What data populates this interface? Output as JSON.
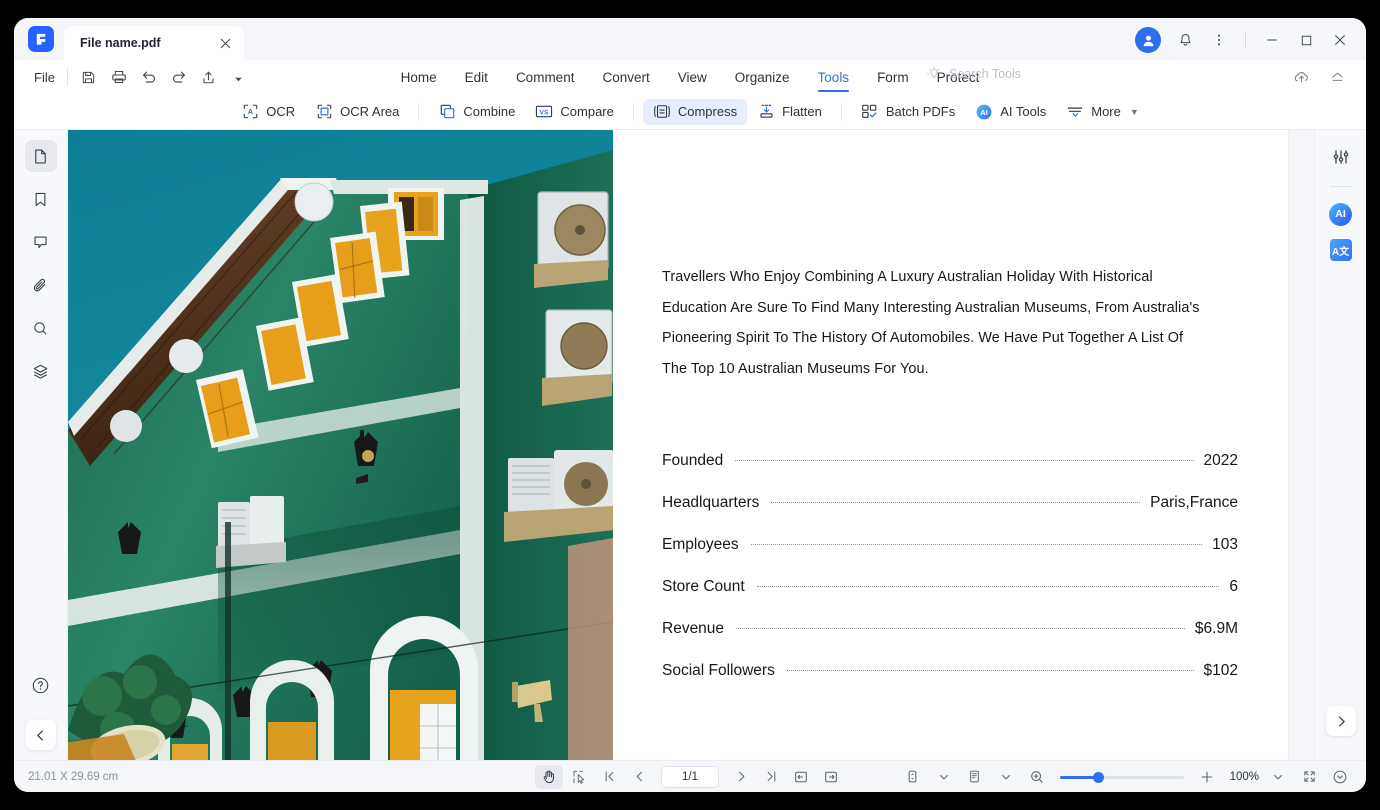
{
  "window": {
    "logo_icon": "pdfelement-logo-icon",
    "tab_title": "File name.pdf",
    "close_tab_icon": "close-icon",
    "account_icon": "user-avatar-icon",
    "notification_icon": "bell-icon",
    "overflow_icon": "kebab-menu-icon",
    "minimize_icon": "minimize-icon",
    "maximize_icon": "maximize-icon",
    "close_icon": "close-window-icon"
  },
  "quick_access": {
    "file_label": "File",
    "items": [
      {
        "name": "save-button",
        "icon": "save-icon"
      },
      {
        "name": "print-button",
        "icon": "print-icon"
      },
      {
        "name": "undo-button",
        "icon": "undo-icon"
      },
      {
        "name": "redo-button",
        "icon": "redo-icon"
      },
      {
        "name": "share-button",
        "icon": "share-icon"
      },
      {
        "name": "customize-toolbar-button",
        "icon": "chevron-down-filled-icon"
      }
    ]
  },
  "main_tabs": [
    {
      "label": "Home",
      "active": false
    },
    {
      "label": "Edit",
      "active": false
    },
    {
      "label": "Comment",
      "active": false
    },
    {
      "label": "Convert",
      "active": false
    },
    {
      "label": "View",
      "active": false
    },
    {
      "label": "Organize",
      "active": false
    },
    {
      "label": "Tools",
      "active": true
    },
    {
      "label": "Form",
      "active": false
    },
    {
      "label": "Protect",
      "active": false
    }
  ],
  "search": {
    "icon": "lightbulb-icon",
    "placeholder": "Search Tools"
  },
  "ribbon_right": {
    "cloud_icon": "cloud-upload-icon",
    "collapse_icon": "collapse-ribbon-icon"
  },
  "tools_ribbon": [
    {
      "label": "OCR",
      "icon": "ocr-icon",
      "active": false
    },
    {
      "label": "OCR Area",
      "icon": "ocr-area-icon",
      "active": false
    },
    {
      "label": "Combine",
      "icon": "combine-icon",
      "active": false
    },
    {
      "label": "Compare",
      "icon": "compare-vs-icon",
      "active": false
    },
    {
      "label": "Compress",
      "icon": "compress-icon",
      "active": true
    },
    {
      "label": "Flatten",
      "icon": "flatten-icon",
      "active": false
    },
    {
      "label": "Batch PDFs",
      "icon": "batch-pdfs-icon",
      "active": false
    },
    {
      "label": "AI Tools",
      "icon": "ai-tools-icon",
      "active": false
    },
    {
      "label": "More",
      "icon": "more-lines-icon",
      "active": false
    }
  ],
  "left_rail": [
    {
      "name": "sidebar-item-thumbnails",
      "icon": "page-thumbnail-icon",
      "active": true
    },
    {
      "name": "sidebar-item-bookmarks",
      "icon": "bookmark-icon",
      "active": false
    },
    {
      "name": "sidebar-item-comments",
      "icon": "comment-icon",
      "active": false
    },
    {
      "name": "sidebar-item-attachments",
      "icon": "paperclip-icon",
      "active": false
    },
    {
      "name": "sidebar-item-search",
      "icon": "search-icon",
      "active": false
    },
    {
      "name": "sidebar-item-layers",
      "icon": "layers-icon",
      "active": false
    }
  ],
  "left_rail_bottom": [
    {
      "name": "help-button",
      "icon": "question-circle-icon"
    },
    {
      "name": "collapse-left-panel-button",
      "icon": "chevron-left-icon"
    }
  ],
  "right_rail": [
    {
      "name": "properties-button",
      "icon": "sliders-icon",
      "label": ""
    },
    {
      "name": "ai-assistant-button",
      "icon": "ai-icon",
      "label": "AI"
    },
    {
      "name": "translate-button",
      "icon": "translate-icon",
      "label": "A"
    }
  ],
  "right_rail_bottom": {
    "name": "next-page-button",
    "icon": "chevron-right-icon"
  },
  "document": {
    "photo_alt": "green-building-photo",
    "paragraph": "Travellers Who Enjoy Combining A Luxury Australian Holiday With Historical Education Are Sure To Find Many Interesting Australian Museums, From Australia's Pioneering Spirit To The History Of Automobiles. We Have Put Together A List Of The Top 10 Australian Museums For You.",
    "rows": [
      {
        "label": "Founded",
        "value": "2022"
      },
      {
        "label": "Headlquarters",
        "value": "Paris,France"
      },
      {
        "label": "Employees",
        "value": "103"
      },
      {
        "label": "Store Count",
        "value": "6"
      },
      {
        "label": "Revenue",
        "value": "$6.9M"
      },
      {
        "label": "Social Followers",
        "value": "$102"
      }
    ]
  },
  "statusbar": {
    "page_dimensions": "21.01 X 29.69 cm",
    "hand_tool_icon": "hand-tool-icon",
    "select_tool_icon": "select-tool-icon",
    "first_page_icon": "first-page-icon",
    "prev_page_icon": "prev-page-icon",
    "page_indicator": "1/1",
    "next_page_icon": "next-page-icon",
    "last_page_icon": "last-page-icon",
    "fit_page_icon": "fit-page-icon",
    "fit_width_icon": "fit-width-icon",
    "scroll_mode_icon": "scroll-mode-icon",
    "page_layout_icon": "page-layout-icon",
    "zoom_out_icon": "zoom-magnifier-icon",
    "zoom_in_icon": "zoom-in-icon",
    "zoom_level": "100%",
    "zoom_dropdown_icon": "chevron-down-icon",
    "fullscreen_icon": "fullscreen-icon",
    "more_icon": "chevron-down-circle-icon"
  },
  "colors": {
    "accent": "#2f6fed",
    "active_tool_bg": "#e6edfd",
    "chrome_bg": "#f4f6f9"
  }
}
